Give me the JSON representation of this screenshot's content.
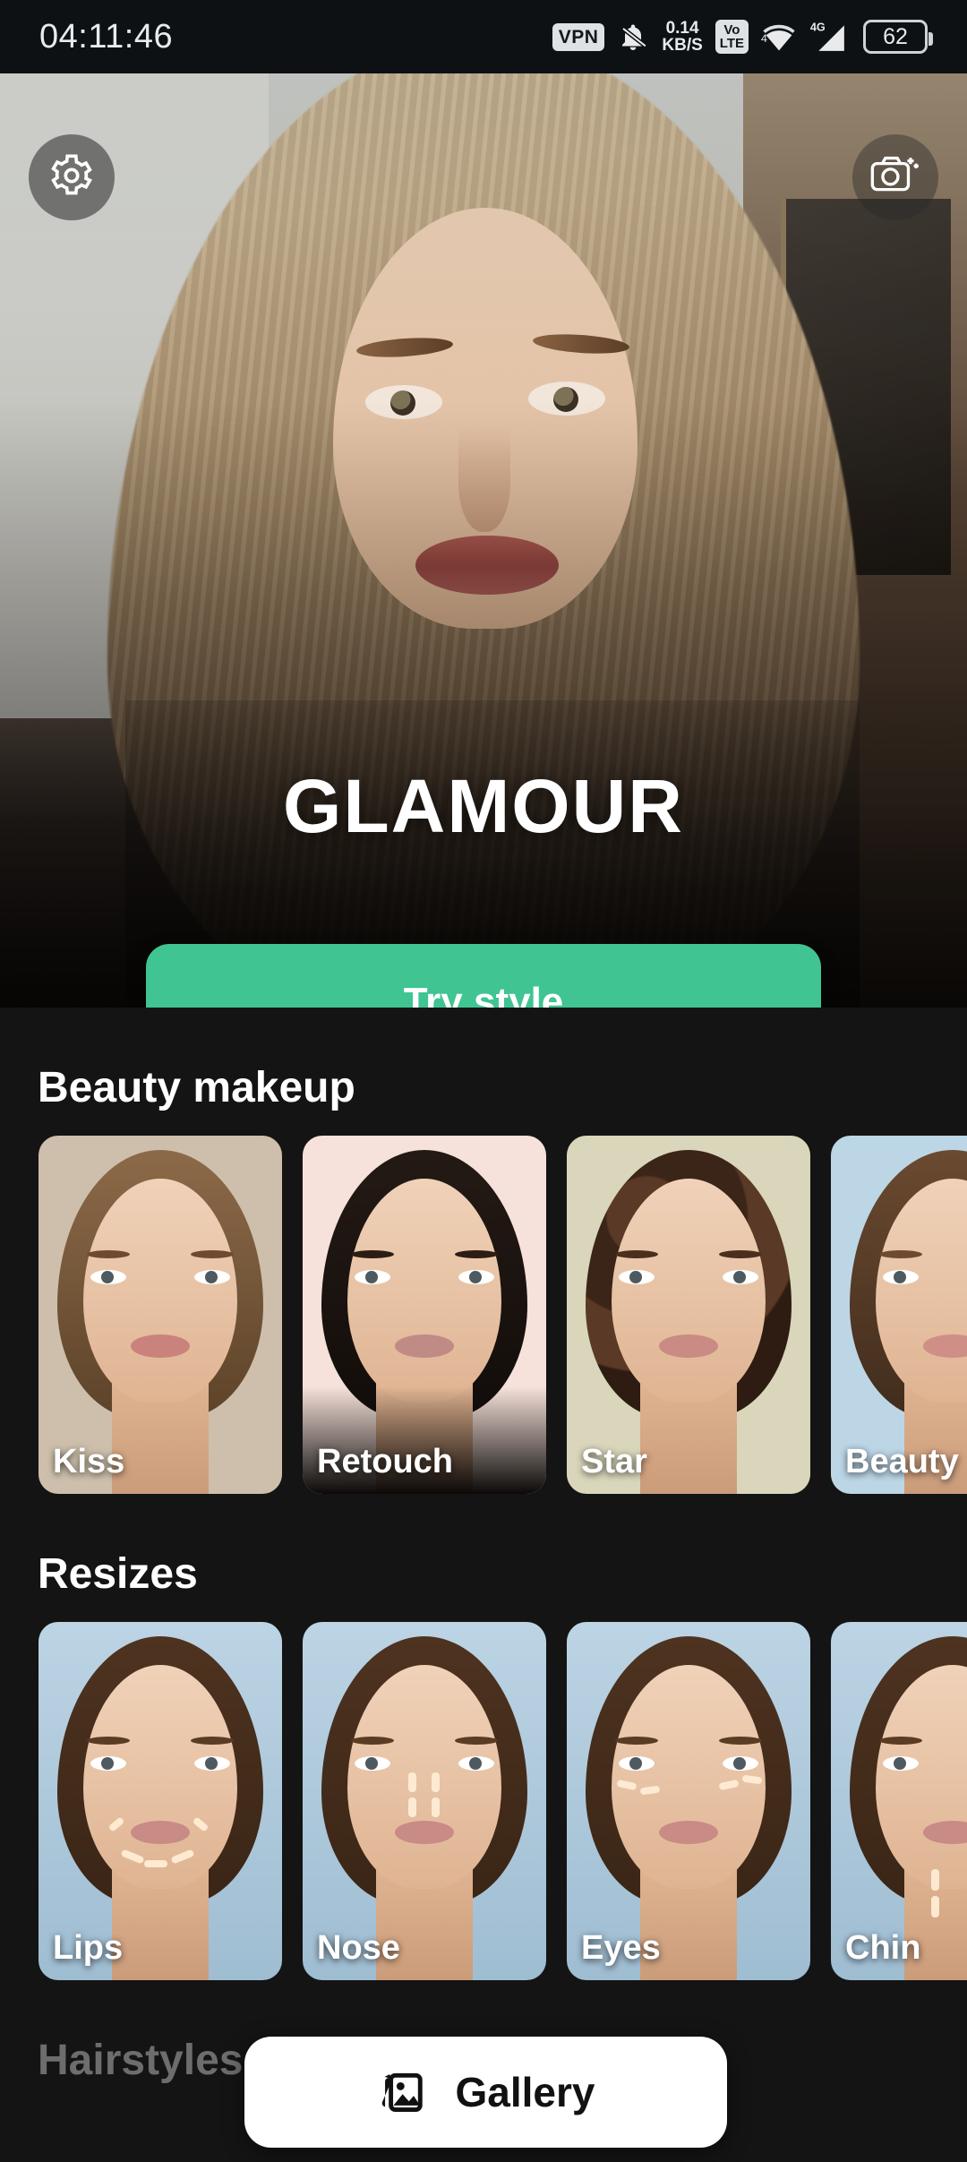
{
  "statusbar": {
    "time": "04:11:46",
    "vpn_badge": "VPN",
    "network_speed_value": "0.14",
    "network_speed_unit": "KB/S",
    "volte_top": "Vo",
    "volte_bottom": "LTE",
    "signal_generation": "4G",
    "battery_level": "62"
  },
  "hero": {
    "title": "GLAMOUR",
    "cta_label": "Try style",
    "settings_icon": "gear-icon",
    "camera_icon": "camera-add-icon",
    "accent_color": "#3fc492"
  },
  "sections": [
    {
      "title": "Beauty makeup",
      "cards": [
        {
          "label": "Kiss",
          "bg": "#cdbfab"
        },
        {
          "label": "Retouch",
          "bg": "#f6e2da"
        },
        {
          "label": "Star",
          "bg": "#d9d6bb"
        },
        {
          "label": "Beauty",
          "bg": "#bcd6e6"
        }
      ]
    },
    {
      "title": "Resizes",
      "cards": [
        {
          "label": "Lips",
          "bg": "#bcd4e4"
        },
        {
          "label": "Nose",
          "bg": "#bcd4e4"
        },
        {
          "label": "Eyes",
          "bg": "#bcd4e4"
        },
        {
          "label": "Chin",
          "bg": "#bcd4e4"
        }
      ]
    },
    {
      "title": "Hairstyles",
      "cards": []
    }
  ],
  "gallery": {
    "label": "Gallery",
    "icon": "photo-stack-icon"
  }
}
